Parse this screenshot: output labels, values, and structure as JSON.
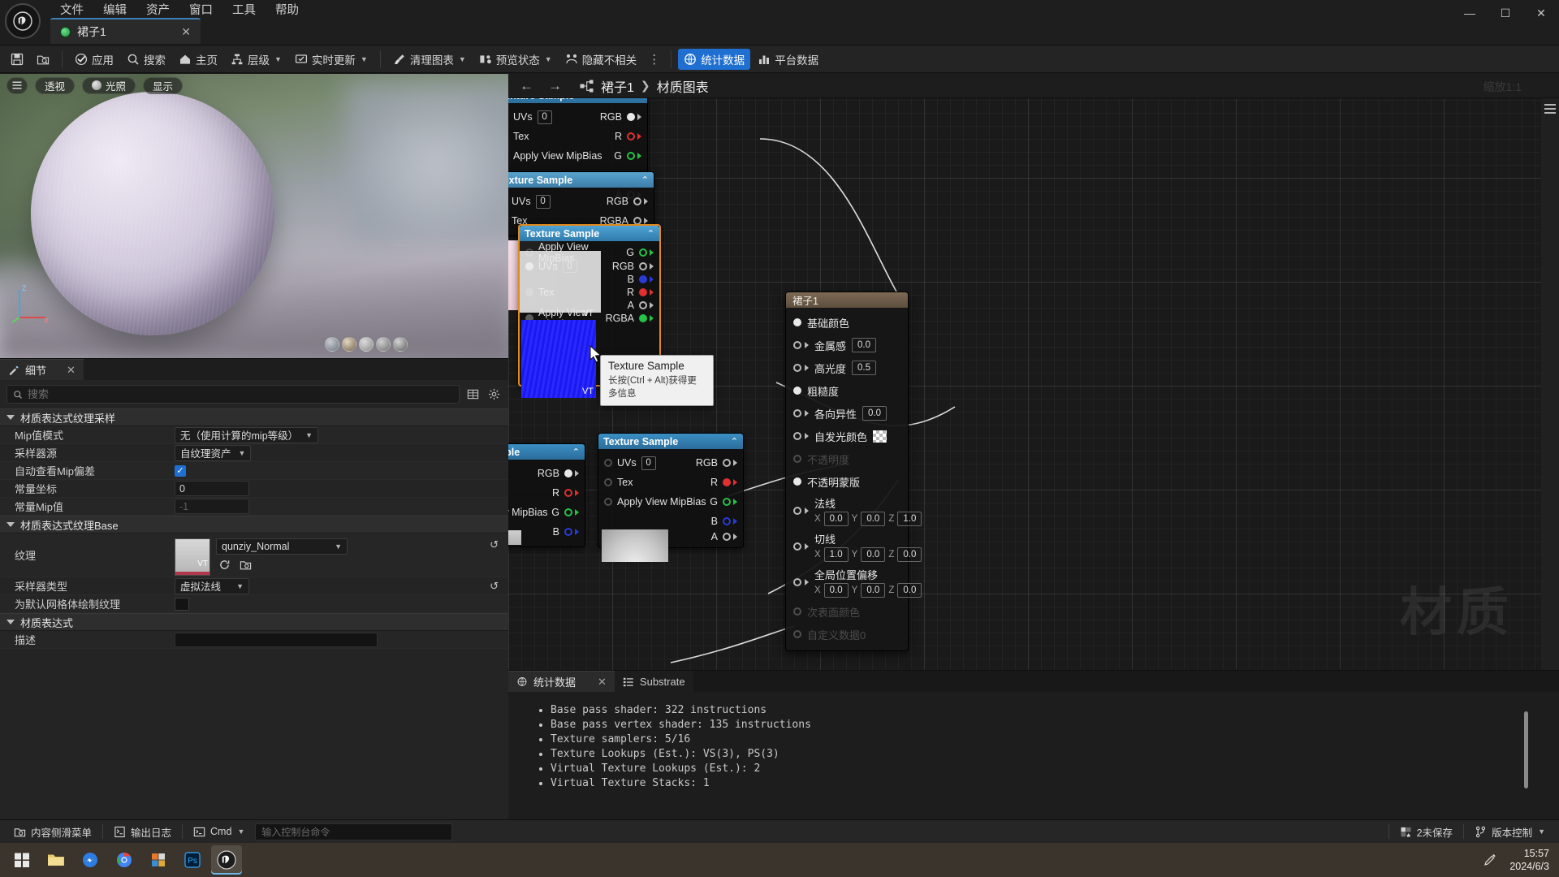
{
  "titlebar": {
    "menus": [
      "文件",
      "编辑",
      "资产",
      "窗口",
      "工具",
      "帮助"
    ],
    "tab_title": "裙子1",
    "tab_close": "✕",
    "win_minimize": "—",
    "win_maximize": "☐",
    "win_close": "✕"
  },
  "toolbar": {
    "save_icon": "save-icon",
    "browse_icon": "browse-icon",
    "apply": "应用",
    "search": "搜索",
    "home": "主页",
    "hierarchy": "层级",
    "live_update": "实时更新",
    "clean_graph": "清理图表",
    "preview_state": "预览状态",
    "hide_unrelated": "隐藏不相关",
    "overflow": "⋮",
    "stats": "统计数据",
    "platform_stats": "平台数据"
  },
  "viewport": {
    "menu_icon": "hamburger-icon",
    "perspective": "透视",
    "lighting": "光照",
    "show": "显示",
    "axis_x": "X",
    "axis_y": "Y",
    "axis_z": "Z"
  },
  "details": {
    "tab_label": "细节",
    "tab_close": "✕",
    "search_placeholder": "搜索",
    "search_value": "",
    "sections": [
      {
        "title": "材质表达式纹理采样",
        "rows": [
          {
            "label": "Mip值模式",
            "type": "combo",
            "value": "无（使用计算的mip等级）"
          },
          {
            "label": "采样器源",
            "type": "combo",
            "value": "自纹理资产"
          },
          {
            "label": "自动查看Mip偏差",
            "type": "checkbox",
            "value": "checked"
          },
          {
            "label": "常量坐标",
            "type": "number",
            "value": "0"
          },
          {
            "label": "常量Mip值",
            "type": "number-dim",
            "value": "-1"
          }
        ]
      },
      {
        "title": "材质表达式纹理Base",
        "rows": [
          {
            "label": "纹理",
            "type": "texture",
            "value": "qunziy_Normal",
            "thumb_tag": "VT"
          },
          {
            "label": "采样器类型",
            "type": "combo",
            "value": "虚拟法线"
          },
          {
            "label": "为默认网格体绘制纹理",
            "type": "checkbox",
            "value": ""
          }
        ]
      },
      {
        "title": "材质表达式",
        "rows": [
          {
            "label": "描述",
            "type": "text",
            "value": ""
          }
        ]
      }
    ]
  },
  "graph": {
    "back_icon": "arrow-left-icon",
    "forward_icon": "arrow-right-icon",
    "graph_icon": "node-graph-icon",
    "breadcrumb_root": "裙子1",
    "breadcrumb_sep": "❯",
    "breadcrumb_leaf": "材质图表",
    "zoom_label": "缩放1:1",
    "watermark": "材质",
    "tooltip": {
      "title": "Texture Sample",
      "hint": "长按(Ctrl + Alt)获得更多信息"
    },
    "node_title": "Texture Sample",
    "pins_in": [
      "UVs",
      "Tex",
      "Apply View MipBias"
    ],
    "uv_default": "0",
    "pins_out": [
      "RGB",
      "R",
      "G",
      "B",
      "A",
      "RGBA"
    ],
    "vt_tag": "VT"
  },
  "material_node": {
    "title": "裙子1",
    "rows": [
      {
        "label": "基础颜色",
        "kind": "connected"
      },
      {
        "label": "金属感",
        "kind": "value",
        "value": "0.0"
      },
      {
        "label": "高光度",
        "kind": "value",
        "value": "0.5"
      },
      {
        "label": "粗糙度",
        "kind": "connected"
      },
      {
        "label": "各向异性",
        "kind": "value",
        "value": "0.0"
      },
      {
        "label": "自发光颜色",
        "kind": "checker"
      },
      {
        "label": "不透明度",
        "kind": "disabled"
      },
      {
        "label": "不透明蒙版",
        "kind": "connected"
      },
      {
        "label": "法线",
        "kind": "vector",
        "x": "0.0",
        "y": "0.0",
        "z": "1.0"
      },
      {
        "label": "切线",
        "kind": "vector",
        "x": "1.0",
        "y": "0.0",
        "z": "0.0"
      },
      {
        "label": "全局位置偏移",
        "kind": "vector",
        "x": "0.0",
        "y": "0.0",
        "z": "0.0"
      },
      {
        "label": "次表面颜色",
        "kind": "disabled"
      },
      {
        "label": "自定义数据0",
        "kind": "disabled"
      }
    ],
    "axis_x": "X",
    "axis_y": "Y",
    "axis_z": "Z"
  },
  "stats_panel": {
    "tab_active": "统计数据",
    "tab_close": "✕",
    "tab_substrate": "Substrate",
    "lines": [
      "Base pass shader: 322 instructions",
      "Base pass vertex shader: 135 instructions",
      "Texture samplers: 5/16",
      "Texture Lookups (Est.): VS(3), PS(3)",
      "Virtual Texture Lookups (Est.): 2",
      "Virtual Texture Stacks: 1"
    ]
  },
  "statusbar": {
    "content_drawer": "内容侧滑菜单",
    "output_log": "输出日志",
    "cmd_label": "Cmd",
    "cmd_placeholder": "输入控制台命令",
    "unsaved": "2未保存",
    "source_control": "版本控制"
  },
  "taskbar": {
    "apps": [
      "start-icon",
      "file-explorer-icon",
      "messenger-icon",
      "chrome-icon",
      "office-icon",
      "photoshop-icon",
      "unreal-icon"
    ],
    "time": "15:57",
    "date": "2024/6/3",
    "tray_icon": "pen-icon"
  },
  "colors": {
    "accent_blue": "#1f6fd0",
    "node_header": "#3b8fc4",
    "material_header": "#7d6a55",
    "selected_node": "#e08a1e",
    "pin_red": "#e03030",
    "pin_green": "#25c247",
    "pin_blue": "#2a3ad6",
    "taskbar": "#3b342c"
  }
}
